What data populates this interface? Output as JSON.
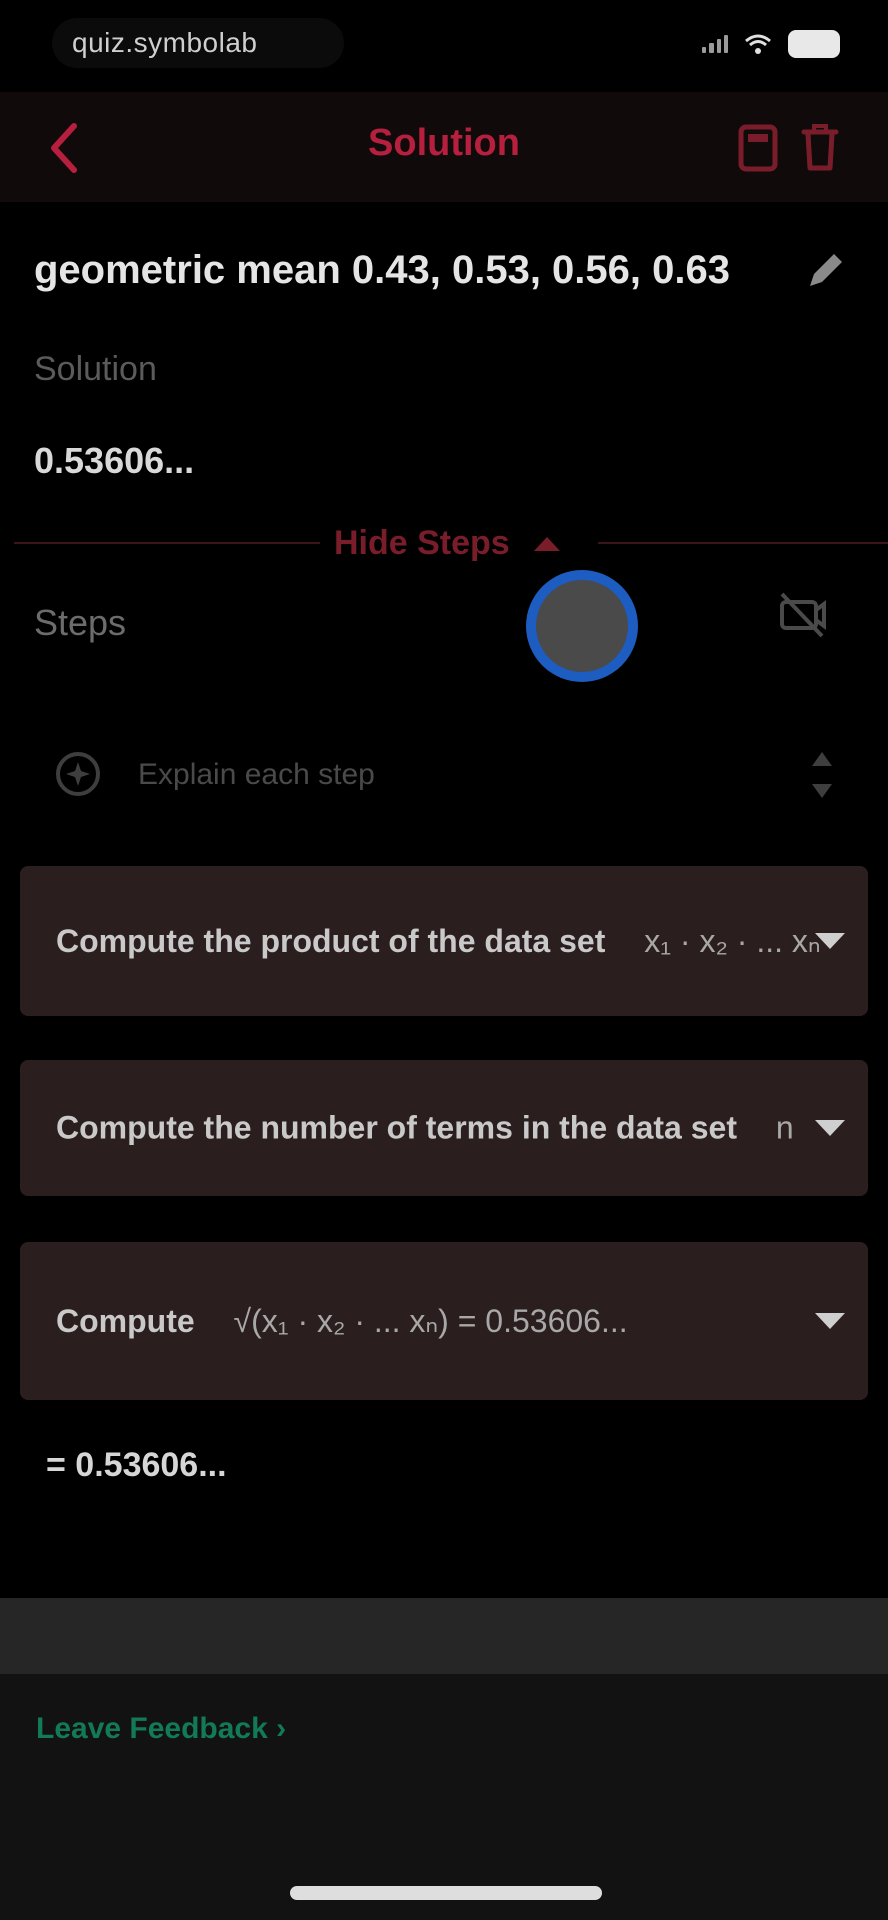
{
  "status_bar": {
    "pill_text": "quiz.symbolab"
  },
  "nav": {
    "title": "Solution"
  },
  "question": {
    "text": "geometric mean 0.43, 0.53, 0.56, 0.63"
  },
  "solution": {
    "label": "Solution",
    "value": "0.53606..."
  },
  "steps_toggle": {
    "label": "Hide Steps"
  },
  "steps": {
    "label": "Steps",
    "explain_placeholder": "Explain each step",
    "items": [
      {
        "text": "Compute the product of the data set",
        "math": "x₁ · x₂ · ... xₙ"
      },
      {
        "text": "Compute the number of terms in the data set",
        "math": "n"
      },
      {
        "text": "Compute",
        "math": "√(x₁ · x₂ · ... xₙ)   = 0.53606..."
      }
    ],
    "result": "= 0.53606..."
  },
  "feedback": {
    "label": "Leave Feedback ›"
  },
  "colors": {
    "accent": "#b61f3d",
    "step_bg": "#2b1e1e",
    "feedback_green": "#137a57"
  }
}
